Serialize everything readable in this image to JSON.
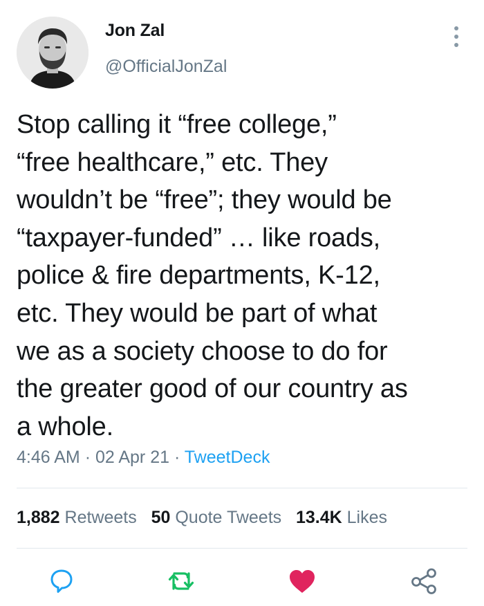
{
  "tweet": {
    "author": {
      "display_name": "Jon Zal",
      "handle": "@OfficialJonZal"
    },
    "text_lines": [
      "Stop calling it “free college,”",
      "“free healthcare,” etc. They",
      "wouldn’t be “free”; they would be",
      "“taxpayer-funded” … like roads,",
      "police & fire departments, K-12,",
      "etc. They would be part of what",
      "we as a society choose to do for",
      "the greater good of our country as",
      "a whole."
    ],
    "time": "4:46 AM",
    "date": "02 Apr 21",
    "separator": "·",
    "source": "TweetDeck"
  },
  "stats": {
    "retweets": {
      "count": "1,882",
      "label": "Retweets"
    },
    "quotes": {
      "count": "50",
      "label": "Quote Tweets"
    },
    "likes": {
      "count": "13.4K",
      "label": "Likes"
    }
  },
  "actions": {
    "reply_icon": "reply-bubble-icon",
    "retweet_icon": "retweet-arrows-icon",
    "like_icon": "heart-icon",
    "share_icon": "share-nodes-icon"
  },
  "colors": {
    "text": "#14171a",
    "muted": "#657786",
    "link": "#1da1f2",
    "reply": "#1da1f2",
    "retweet": "#17bf63",
    "like": "#e0245e",
    "share": "#657786",
    "divider": "#e1e8ed"
  }
}
